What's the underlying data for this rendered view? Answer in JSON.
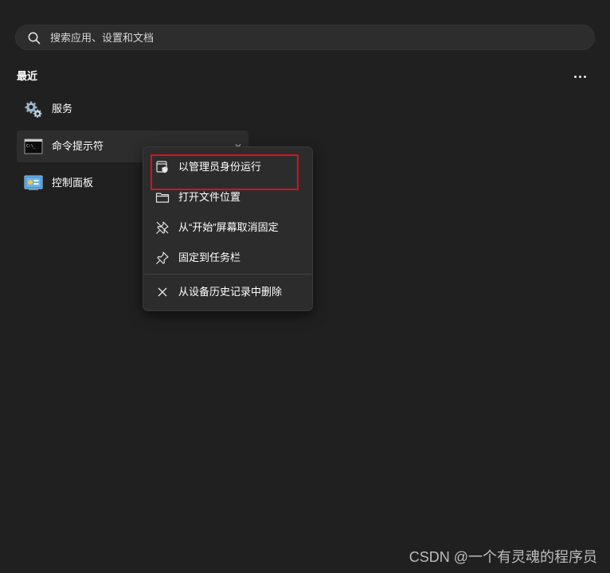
{
  "search": {
    "placeholder": "搜索应用、设置和文档",
    "icon": "search-icon"
  },
  "recent": {
    "title": "最近",
    "more_icon": "more-horizontal-icon",
    "items": [
      {
        "label": "服务",
        "icon": "services-gear-icon"
      },
      {
        "label": "命令提示符",
        "icon": "command-prompt-icon"
      },
      {
        "label": "控制面板",
        "icon": "control-panel-icon"
      }
    ]
  },
  "context_menu": {
    "items": [
      {
        "label": "以管理员身份运行",
        "icon": "shield-admin-icon"
      },
      {
        "label": "打开文件位置",
        "icon": "folder-icon"
      },
      {
        "label": "从“开始”屏幕取消固定",
        "icon": "unpin-icon"
      },
      {
        "label": "固定到任务栏",
        "icon": "pin-icon"
      },
      {
        "label": "从设备历史记录中删除",
        "icon": "close-icon"
      }
    ]
  },
  "watermark": "CSDN @一个有灵魂的程序员",
  "colors": {
    "background": "#202020",
    "surface": "#2d2d2d",
    "menu": "#2c2c2c",
    "highlight": "#d9111b"
  }
}
